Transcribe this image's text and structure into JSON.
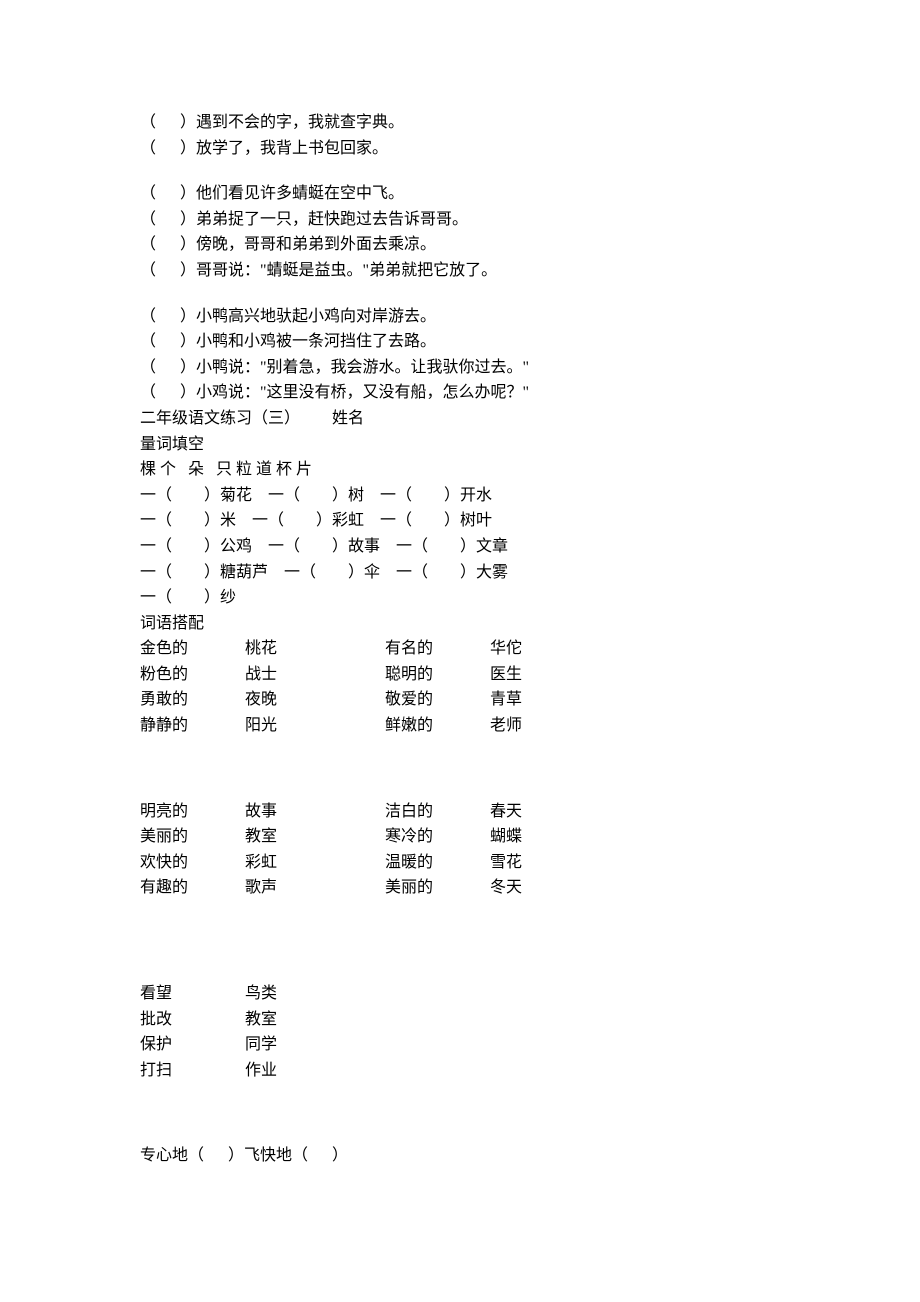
{
  "ordering": {
    "set1": [
      "（      ）遇到不会的字，我就查字典。",
      "（      ）放学了，我背上书包回家。"
    ],
    "set2": [
      "（      ）他们看见许多蜻蜓在空中飞。",
      "（      ）弟弟捉了一只，赶快跑过去告诉哥哥。",
      "（      ）傍晚，哥哥和弟弟到外面去乘凉。",
      "（      ）哥哥说：\"蜻蜓是益虫。\"弟弟就把它放了。"
    ],
    "set3": [
      "（      ）小鸭高兴地驮起小鸡向对岸游去。",
      "（      ）小鸭和小鸡被一条河挡住了去路。",
      "（      ）小鸭说：\"别着急，我会游水。让我驮你过去。\"",
      "（      ）小鸡说：\"这里没有桥，又没有船，怎么办呢？\""
    ]
  },
  "header": "二年级语文练习（三）        姓名",
  "section1_title": "量词填空",
  "measure_words_bank": "棵 个   朵   只 粒 道 杯 片",
  "measure_lines": [
    "一（        ）菊花    一（        ）树    一（        ）开水",
    "一（        ）米    一（        ）彩虹    一（        ）树叶",
    "一（        ）公鸡    一（        ）故事    一（        ）文章",
    "一（        ）糖葫芦    一（        ）伞    一（        ）大雾",
    "一（        ）纱"
  ],
  "section2_title": "词语搭配",
  "match1": [
    [
      "金色的",
      "桃花",
      "有名的",
      "华佗"
    ],
    [
      "粉色的",
      "战士",
      "聪明的",
      "医生"
    ],
    [
      "勇敢的",
      "夜晚",
      "敬爱的",
      "青草"
    ],
    [
      "静静的",
      "阳光",
      "鲜嫩的",
      "老师"
    ]
  ],
  "match2": [
    [
      "明亮的",
      "故事",
      "洁白的",
      "春天"
    ],
    [
      "美丽的",
      "教室",
      "寒冷的",
      "蝴蝶"
    ],
    [
      "欢快的",
      "彩虹",
      "温暖的",
      "雪花"
    ],
    [
      "有趣的",
      "歌声",
      "美丽的",
      "冬天"
    ]
  ],
  "match3": [
    [
      "看望",
      "鸟类"
    ],
    [
      "批改",
      "教室"
    ],
    [
      "保护",
      "同学"
    ],
    [
      "打扫",
      "作业"
    ]
  ],
  "final_line": "专心地（      ）飞快地（      ）"
}
